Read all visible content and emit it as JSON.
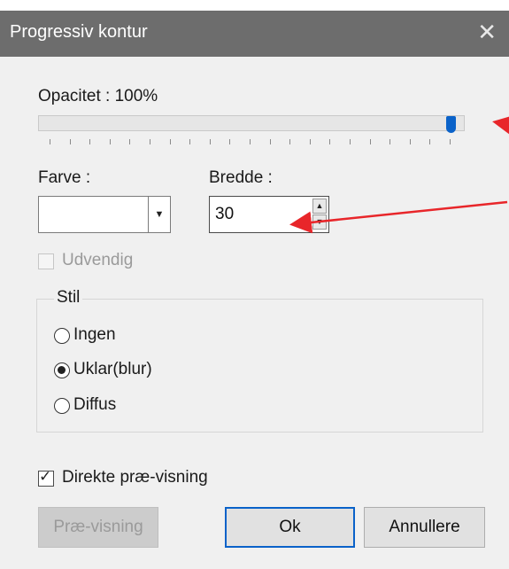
{
  "window": {
    "title": "Progressiv kontur",
    "close_glyph": "✕"
  },
  "opacity": {
    "label": "Opacitet : 100%",
    "value_percent": 100,
    "tick_count": 20
  },
  "color": {
    "label": "Farve :",
    "value": ""
  },
  "width": {
    "label": "Bredde :",
    "value": "30"
  },
  "outside": {
    "label": "Udvendig",
    "checked": false,
    "enabled": false
  },
  "style": {
    "legend": "Stil",
    "options": [
      {
        "label": "Ingen",
        "selected": false
      },
      {
        "label": "Uklar(blur)",
        "selected": true
      },
      {
        "label": "Diffus",
        "selected": false
      }
    ]
  },
  "live_preview": {
    "label": "Direkte præ-visning",
    "checked": true
  },
  "buttons": {
    "preview": "Præ-visning",
    "ok": "Ok",
    "cancel": "Annullere"
  },
  "colors": {
    "accent": "#0a62c9",
    "annotation_arrow": "#e8262a",
    "titlebar": "#6d6d6d"
  },
  "icons": {
    "combo_arrow": "▼",
    "spin_up": "▲",
    "spin_down": "▼"
  }
}
